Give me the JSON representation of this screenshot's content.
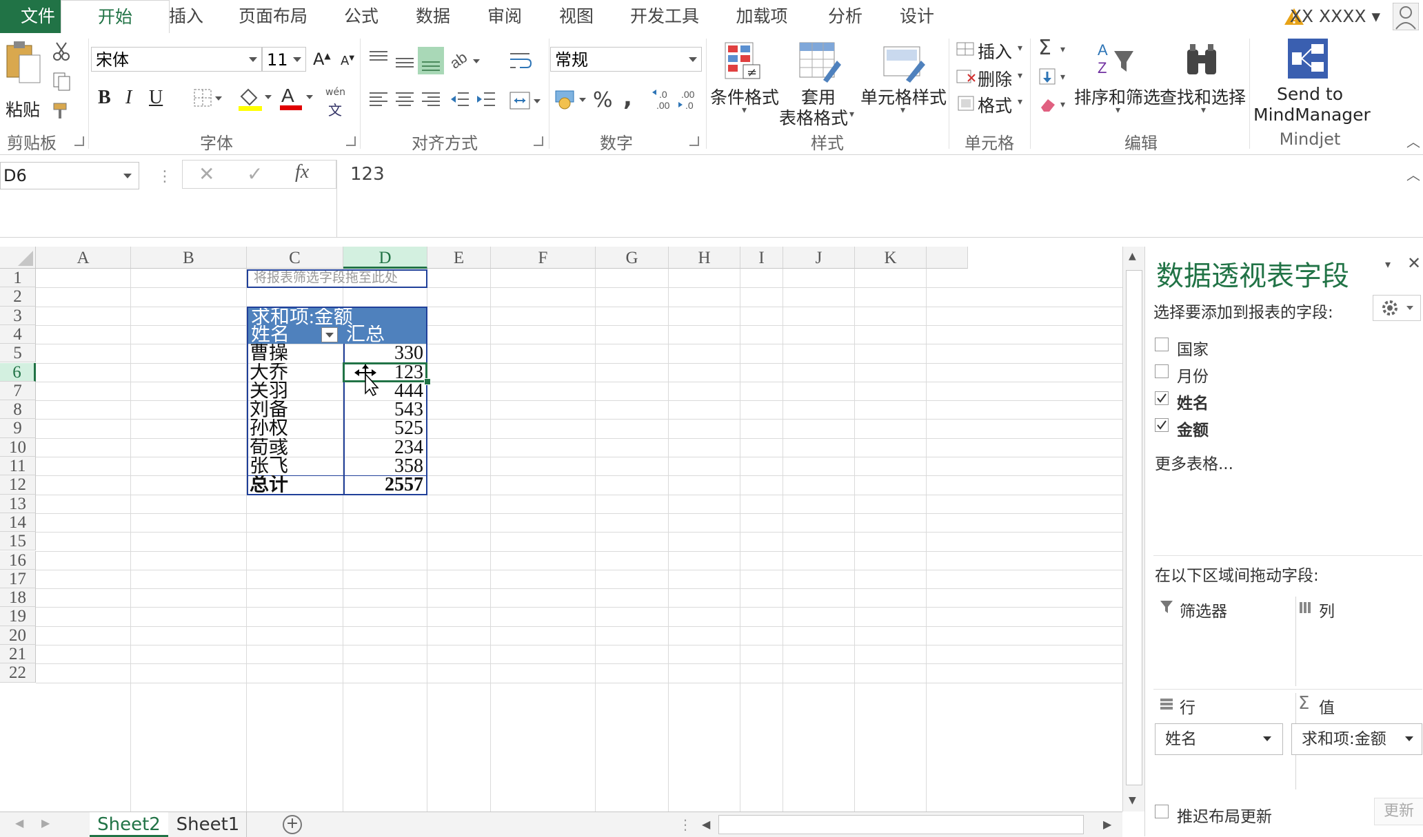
{
  "tabs": {
    "file": "文件",
    "items": [
      "开始",
      "插入",
      "页面布局",
      "公式",
      "数据",
      "审阅",
      "视图",
      "开发工具",
      "加载项",
      "分析",
      "设计"
    ]
  },
  "user": {
    "name": "XX XXXX"
  },
  "ribbon": {
    "clipboard": {
      "paste": "粘贴",
      "label": "剪贴板"
    },
    "font": {
      "name": "宋体",
      "size": "11",
      "label": "字体",
      "bold": "B",
      "italic": "I",
      "underline": "U",
      "phonetic_top": "wén",
      "phonetic_bottom": "文"
    },
    "align": {
      "label": "对齐方式"
    },
    "number": {
      "format": "常规",
      "label": "数字",
      "percent": "%",
      "comma": ","
    },
    "styles": {
      "conditional": "条件格式",
      "table_1": "套用",
      "table_2": "表格格式",
      "cell_style": "单元格样式",
      "label": "样式"
    },
    "cells": {
      "insert": "插入",
      "delete": "删除",
      "format": "格式",
      "label": "单元格"
    },
    "editing": {
      "sort": "排序和筛选",
      "find": "查找和选择",
      "label": "编辑"
    },
    "mindjet": {
      "line1": "Send to",
      "line2": "MindManager",
      "label": "Mindjet"
    }
  },
  "formula_bar": {
    "name_box": "D6",
    "fx": "fx",
    "value": "123"
  },
  "grid": {
    "columns": [
      "A",
      "B",
      "C",
      "D",
      "E",
      "F",
      "G",
      "H",
      "I",
      "J",
      "K"
    ],
    "rows": [
      "1",
      "2",
      "3",
      "4",
      "5",
      "6",
      "7",
      "8",
      "9",
      "10",
      "11",
      "12",
      "13",
      "14",
      "15",
      "16",
      "17",
      "18",
      "19",
      "20",
      "21",
      "22"
    ],
    "filter_placeholder": "将报表筛选字段拖至此处"
  },
  "pivot": {
    "title": "求和项:金额",
    "row_header": "姓名",
    "value_header": "汇总",
    "rows": [
      {
        "name": "曹操",
        "value": "330"
      },
      {
        "name": "大乔",
        "value": "123"
      },
      {
        "name": "关羽",
        "value": "444"
      },
      {
        "name": "刘备",
        "value": "543"
      },
      {
        "name": "孙权",
        "value": "525"
      },
      {
        "name": "荀彧",
        "value": "234"
      },
      {
        "name": "张飞",
        "value": "358"
      }
    ],
    "total_label": "总计",
    "total_value": "2557"
  },
  "pane": {
    "title": "数据透视表字段",
    "subtitle": "选择要添加到报表的字段:",
    "fields": [
      {
        "label": "国家",
        "checked": false
      },
      {
        "label": "月份",
        "checked": false
      },
      {
        "label": "姓名",
        "checked": true
      },
      {
        "label": "金额",
        "checked": true
      }
    ],
    "more_tables": "更多表格...",
    "drag_hint": "在以下区域间拖动字段:",
    "filters": "筛选器",
    "columns": "列",
    "rows": "行",
    "values": "值",
    "rows_value": "姓名",
    "values_value": "求和项:金额",
    "defer": "推迟布局更新",
    "update": "更新"
  },
  "sheets": [
    "Sheet2",
    "Sheet1"
  ],
  "colors": {
    "accent": "#217346",
    "pivot_header": "#4f81bd",
    "pivot_border": "#1f3f99"
  }
}
